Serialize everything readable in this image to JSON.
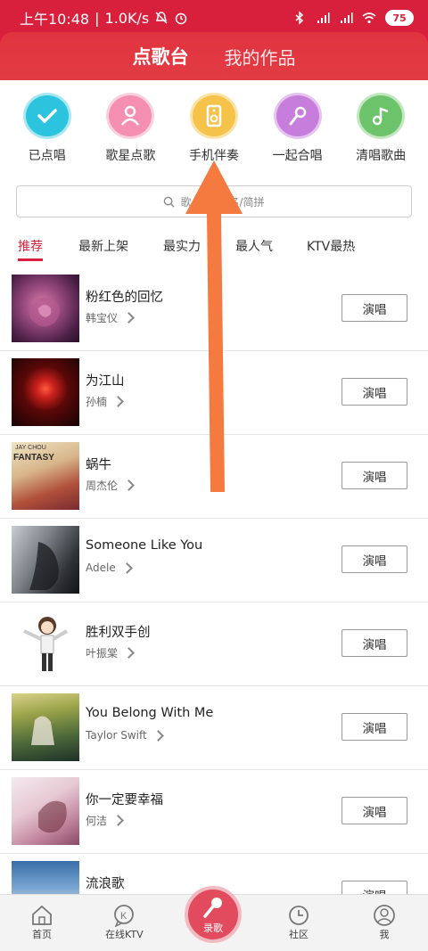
{
  "status_bar": {
    "time": "上午10:48",
    "speed": "1.0K/s",
    "battery": "75"
  },
  "header": {
    "tabs": [
      {
        "label": "点歌台"
      },
      {
        "label": "我的作品"
      }
    ]
  },
  "categories": [
    {
      "label": "已点唱",
      "color": "#2bc3dd",
      "icon": "check-icon"
    },
    {
      "label": "歌星点歌",
      "color": "#f48fb1",
      "icon": "singer-icon"
    },
    {
      "label": "手机伴奏",
      "color": "#f5c24a",
      "icon": "speaker-icon"
    },
    {
      "label": "一起合唱",
      "color": "#c77ddc",
      "icon": "microphone-icon"
    },
    {
      "label": "清唱歌曲",
      "color": "#6cc36a",
      "icon": "music-note-icon"
    }
  ],
  "search": {
    "placeholder_left": "歌",
    "placeholder_right": "名/简拼"
  },
  "sub_tabs": [
    "推荐",
    "最新上架",
    "最实力",
    "最人气",
    "KTV最热"
  ],
  "songs": [
    {
      "title": "粉红色的回忆",
      "artist": "韩宝仪",
      "button": "演唱"
    },
    {
      "title": "为江山",
      "artist": "孙楠",
      "button": "演唱"
    },
    {
      "title": "蜗牛",
      "artist": "周杰伦",
      "button": "演唱",
      "cover_text_1": "JAY CHOU",
      "cover_text_2": "FANTASY"
    },
    {
      "title": "Someone Like You",
      "artist": "Adele",
      "button": "演唱"
    },
    {
      "title": "胜利双手创",
      "artist": "叶振棠",
      "button": "演唱"
    },
    {
      "title": "You Belong With Me",
      "artist": "Taylor Swift",
      "button": "演唱"
    },
    {
      "title": "你一定要幸福",
      "artist": "何洁",
      "button": "演唱"
    },
    {
      "title": "流浪歌",
      "artist": "",
      "button": "演唱"
    }
  ],
  "bottom_nav": {
    "home": "首页",
    "ktv": "在线KTV",
    "record": "录歌",
    "community": "社区",
    "me": "我"
  },
  "colors": {
    "brand_red": "#d8203c",
    "arrow": "#f47a3f"
  }
}
